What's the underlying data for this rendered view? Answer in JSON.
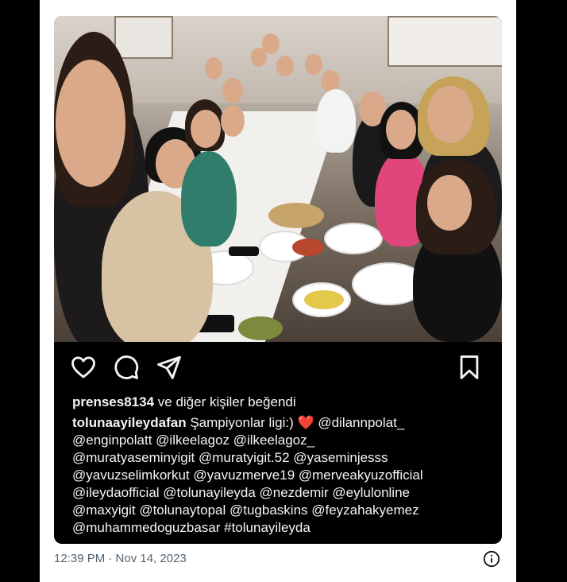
{
  "post": {
    "likes_user": "prenses8134",
    "likes_rest": "ve diğer kişiler beğendi",
    "caption_user": "tolunaayileydafan",
    "caption_text": "Şampiyonlar ligi:) ❤️ @dilannpolat_\n@enginpolatt @ilkeelagoz @ilkeelagoz_\n@muratyaseminyigit @muratyigit.52 @yaseminjesss\n@yavuzselimkorkut @yavuzmerve19 @merveakyuzofficial\n@ileydaofficial @tolunayileyda @nezdemir @eylulonline\n@maxyigit @tolunaytopal @tugbaskins @feyzahakyemez\n@muhammedoguzbasar #tolunayileyda",
    "icons": [
      "heart-icon",
      "comment-icon",
      "share-icon",
      "bookmark-icon"
    ]
  },
  "tweet": {
    "timestamp": "12:39 PM · Nov 14, 2023",
    "info_icon": "info-icon"
  },
  "colors": {
    "page_bg": "#000000",
    "card_bg": "#ffffff",
    "post_bg": "#000000",
    "text_light": "#f5f5f5",
    "muted": "#536471",
    "heart": "#e0245e"
  }
}
